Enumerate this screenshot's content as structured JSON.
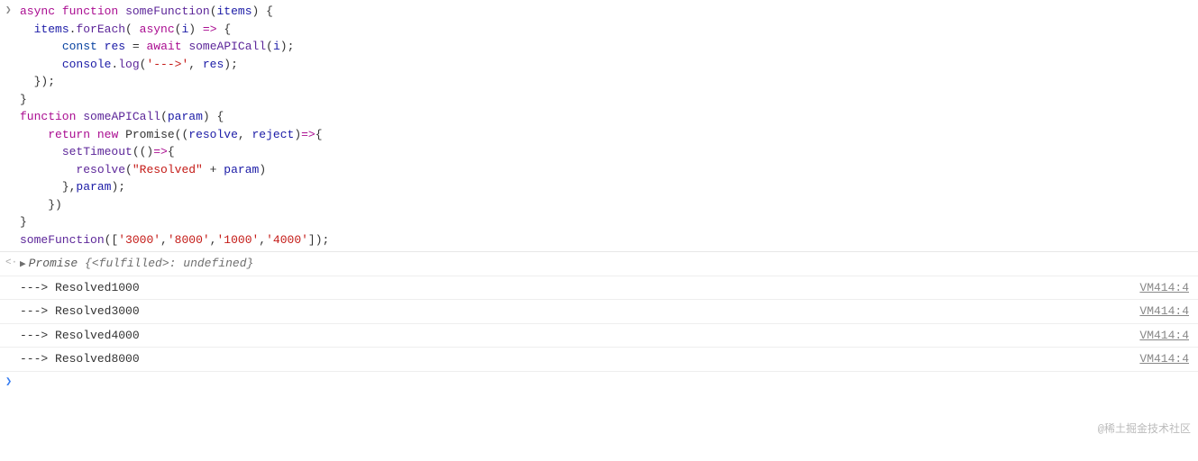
{
  "code": {
    "line1_async": "async",
    "line1_function": "function",
    "line1_fname": "someFunction",
    "line1_param": "items",
    "line2_items": "items",
    "line2_forEach": "forEach",
    "line2_async": "async",
    "line2_i": "i",
    "line3_const": "const",
    "line3_res": "res",
    "line3_await": "await",
    "line3_call": "someAPICall",
    "line3_i": "i",
    "line4_console": "console",
    "line4_log": "log",
    "line4_str": "'--->'",
    "line4_res": "res",
    "line7_function": "function",
    "line7_fname": "someAPICall",
    "line7_param": "param",
    "line8_return": "return",
    "line8_new": "new",
    "line8_Promise": "Promise",
    "line8_resolve": "resolve",
    "line8_reject": "reject",
    "line9_setTimeout": "setTimeout",
    "line10_resolve": "resolve",
    "line10_str": "\"Resolved\"",
    "line10_param": "param",
    "line11_param": "param",
    "line14_call": "someFunction",
    "line14_a1": "'3000'",
    "line14_a2": "'8000'",
    "line14_a3": "'1000'",
    "line14_a4": "'4000'"
  },
  "return_value": {
    "type": "Promise",
    "state_label": "<fulfilled>",
    "value": "undefined"
  },
  "logs": [
    {
      "arrow": "--->",
      "text": "Resolved1000",
      "source": "VM414:4"
    },
    {
      "arrow": "--->",
      "text": "Resolved3000",
      "source": "VM414:4"
    },
    {
      "arrow": "--->",
      "text": "Resolved4000",
      "source": "VM414:4"
    },
    {
      "arrow": "--->",
      "text": "Resolved8000",
      "source": "VM414:4"
    }
  ],
  "watermark": "@稀土掘金技术社区"
}
